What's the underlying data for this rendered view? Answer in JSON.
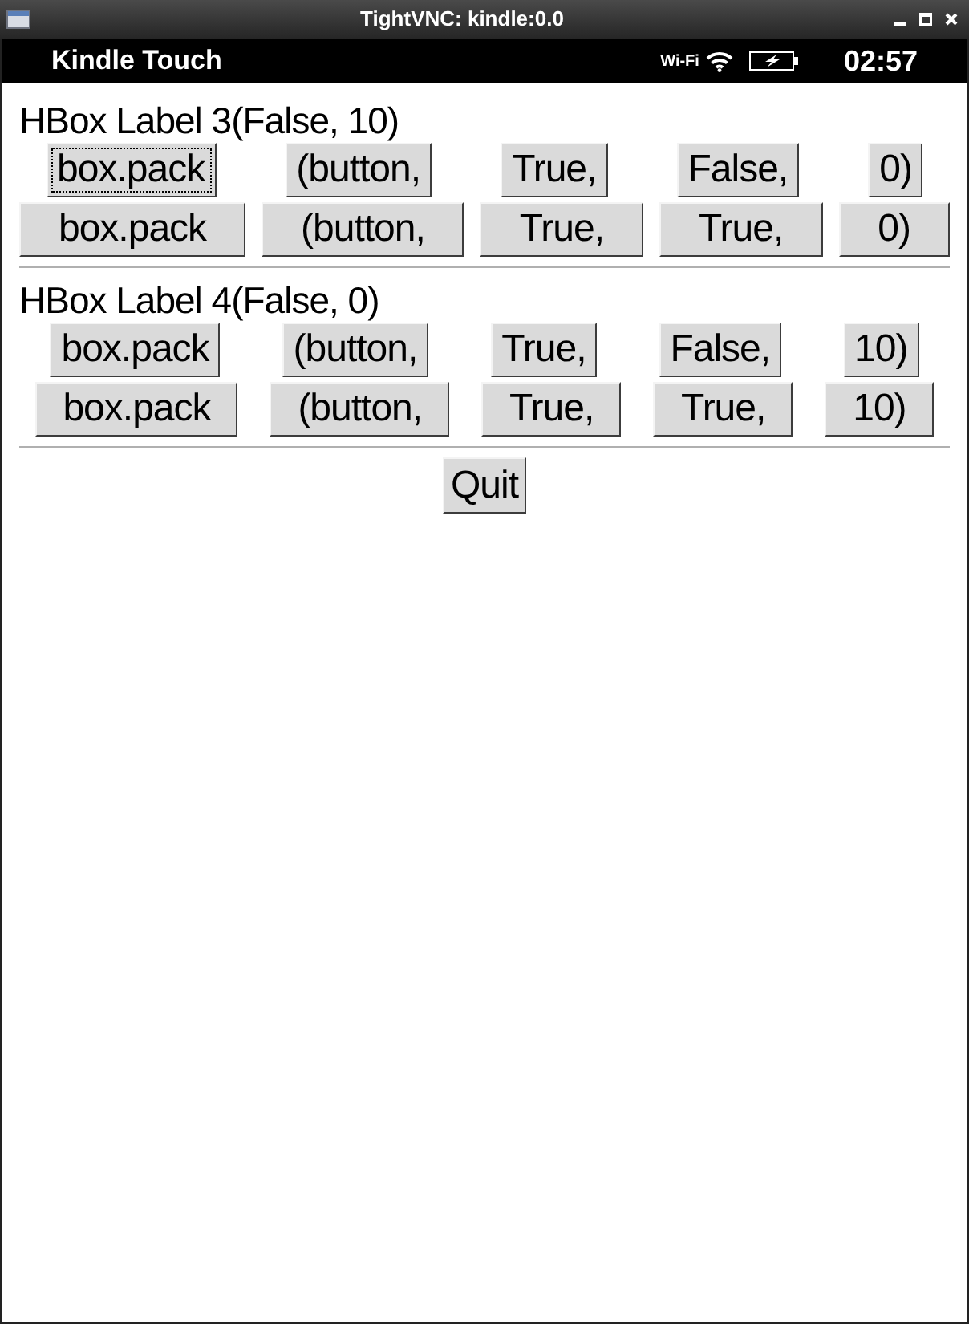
{
  "window": {
    "title": "TightVNC: kindle:0.0"
  },
  "status_bar": {
    "device": "Kindle Touch",
    "wifi_label": "Wi-Fi",
    "time": "02:57"
  },
  "sections": [
    {
      "label": "HBox Label 3(False, 10)",
      "kind": "spacing",
      "rows": [
        {
          "kind": "centered",
          "buttons": [
            {
              "label": "box.pack",
              "focused": true
            },
            {
              "label": "(button,",
              "focused": false
            },
            {
              "label": "True,",
              "focused": false
            },
            {
              "label": "False,",
              "focused": false
            },
            {
              "label": "0)",
              "focused": false
            }
          ]
        },
        {
          "kind": "filled",
          "buttons": [
            {
              "label": "box.pack",
              "focused": false
            },
            {
              "label": "(button,",
              "focused": false
            },
            {
              "label": "True,",
              "focused": false
            },
            {
              "label": "True,",
              "focused": false
            },
            {
              "label": "0)",
              "focused": false
            }
          ]
        }
      ]
    },
    {
      "label": "HBox Label 4(False, 0)",
      "kind": "padding",
      "rows": [
        {
          "kind": "centered",
          "buttons": [
            {
              "label": "box.pack",
              "focused": false
            },
            {
              "label": "(button,",
              "focused": false
            },
            {
              "label": "True,",
              "focused": false
            },
            {
              "label": "False,",
              "focused": false
            },
            {
              "label": "10)",
              "focused": false
            }
          ]
        },
        {
          "kind": "filled",
          "buttons": [
            {
              "label": "box.pack",
              "focused": false
            },
            {
              "label": "(button,",
              "focused": false
            },
            {
              "label": "True,",
              "focused": false
            },
            {
              "label": "True,",
              "focused": false
            },
            {
              "label": "10)",
              "focused": false
            }
          ]
        }
      ]
    }
  ],
  "quit_button": {
    "label": "Quit"
  }
}
